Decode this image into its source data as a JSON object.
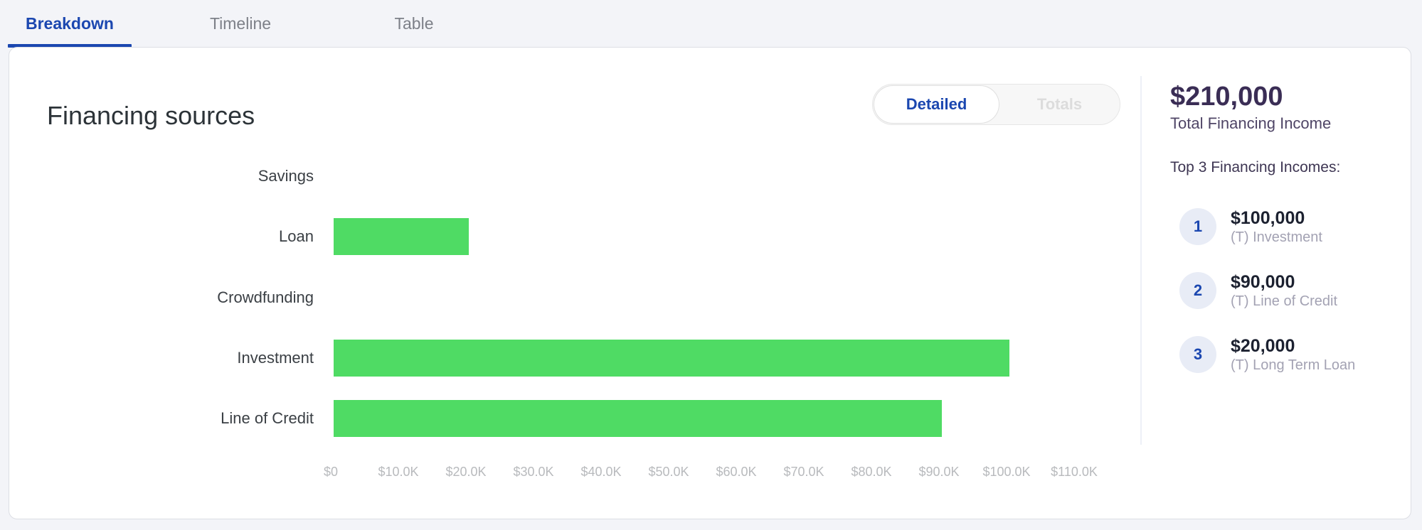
{
  "tabs": [
    {
      "label": "Breakdown",
      "active": true
    },
    {
      "label": "Timeline",
      "active": false
    },
    {
      "label": "Table",
      "active": false
    }
  ],
  "card": {
    "title": "Financing sources",
    "view_toggle": {
      "options": [
        "Detailed",
        "Totals"
      ],
      "selected": "Detailed"
    }
  },
  "summary": {
    "total_value": "$210,000",
    "total_label": "Total Financing Income",
    "top_heading": "Top 3 Financing Incomes:",
    "top_items": [
      {
        "rank": "1",
        "amount": "$100,000",
        "name": "(T) Investment"
      },
      {
        "rank": "2",
        "amount": "$90,000",
        "name": "(T) Line of Credit"
      },
      {
        "rank": "3",
        "amount": "$20,000",
        "name": "(T) Long Term Loan"
      }
    ]
  },
  "colors": {
    "accent": "#1b47b0",
    "bar": "#4fdb64"
  },
  "chart_data": {
    "type": "bar",
    "orientation": "horizontal",
    "title": "Financing sources",
    "xlabel": "",
    "ylabel": "",
    "categories": [
      "Savings",
      "Loan",
      "Crowdfunding",
      "Investment",
      "Line of Credit"
    ],
    "values": [
      0,
      20000,
      0,
      100000,
      90000
    ],
    "xlim": [
      0,
      110000
    ],
    "xticks": [
      0,
      10000,
      20000,
      30000,
      40000,
      50000,
      60000,
      70000,
      80000,
      90000,
      100000,
      110000
    ],
    "xtick_labels": [
      "$0",
      "$10.0K",
      "$20.0K",
      "$30.0K",
      "$40.0K",
      "$50.0K",
      "$60.0K",
      "$70.0K",
      "$80.0K",
      "$90.0K",
      "$100.0K",
      "$110.0K"
    ],
    "grid": false,
    "legend": "none"
  }
}
